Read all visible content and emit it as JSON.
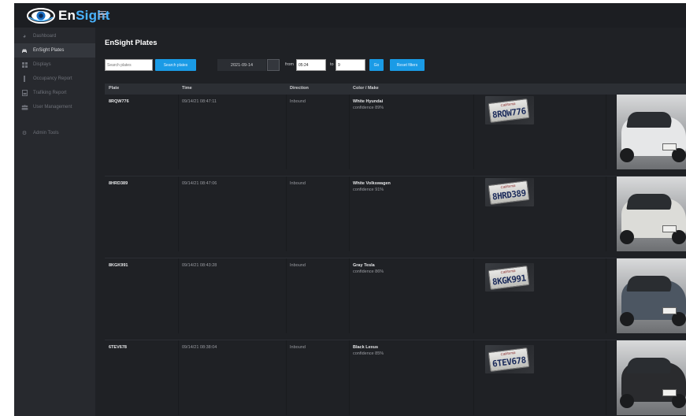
{
  "app": {
    "logo_text_en": "En",
    "logo_text_sight": "Sight"
  },
  "sidebar": {
    "items": [
      {
        "label": "Dashboard",
        "icon": "dashboard-icon",
        "active": false
      },
      {
        "label": "EnSight Plates",
        "icon": "car-icon",
        "active": true
      },
      {
        "label": "Displays",
        "icon": "grid-icon",
        "active": false
      },
      {
        "label": "Occupancy Report",
        "icon": "bars-icon",
        "active": false
      },
      {
        "label": "Trafiking Report",
        "icon": "report-icon",
        "active": false
      },
      {
        "label": "User Management",
        "icon": "users-icon",
        "active": false
      },
      {
        "label": "Admin Tools",
        "icon": "gear-icon",
        "active": false
      }
    ]
  },
  "page": {
    "title": "EnSight Plates"
  },
  "filters": {
    "search_placeholder": "Search plates",
    "search_button": "Search plates",
    "date_value": "2021-09-14",
    "from_label": "from",
    "from_value": "05:24",
    "to_label": "to",
    "to_value": "9",
    "go_button": "Go",
    "reset_button": "Reset filters"
  },
  "table": {
    "columns": [
      "Plate",
      "Time",
      "Direction",
      "Color / Make"
    ],
    "rows": [
      {
        "plate": "8RQW776",
        "time": "09/14/21 08:47:11",
        "direction": "Inbound",
        "make": "White Hyundai",
        "confidence": "confidence 89%",
        "plate_img_text": "8RQW776",
        "car_color": "#e6e7e8"
      },
      {
        "plate": "8HRD389",
        "time": "09/14/21 08:47:06",
        "direction": "Inbound",
        "make": "White Volkswagen",
        "confidence": "confidence 91%",
        "plate_img_text": "8HRD389",
        "car_color": "#dcdcd8"
      },
      {
        "plate": "8KGK991",
        "time": "09/14/21 08:43:28",
        "direction": "Inbound",
        "make": "Gray Tesla",
        "confidence": "confidence 86%",
        "plate_img_text": "8KGK991",
        "car_color": "#4c5662"
      },
      {
        "plate": "6TEV678",
        "time": "09/14/21 08:38:04",
        "direction": "Inbound",
        "make": "Black Lexus",
        "confidence": "confidence 85%",
        "plate_img_text": "6TEV678",
        "car_color": "#2a2b2e"
      }
    ]
  },
  "colors": {
    "accent": "#1a9be6",
    "background": "#1f2125",
    "sidebar": "#27292e"
  }
}
